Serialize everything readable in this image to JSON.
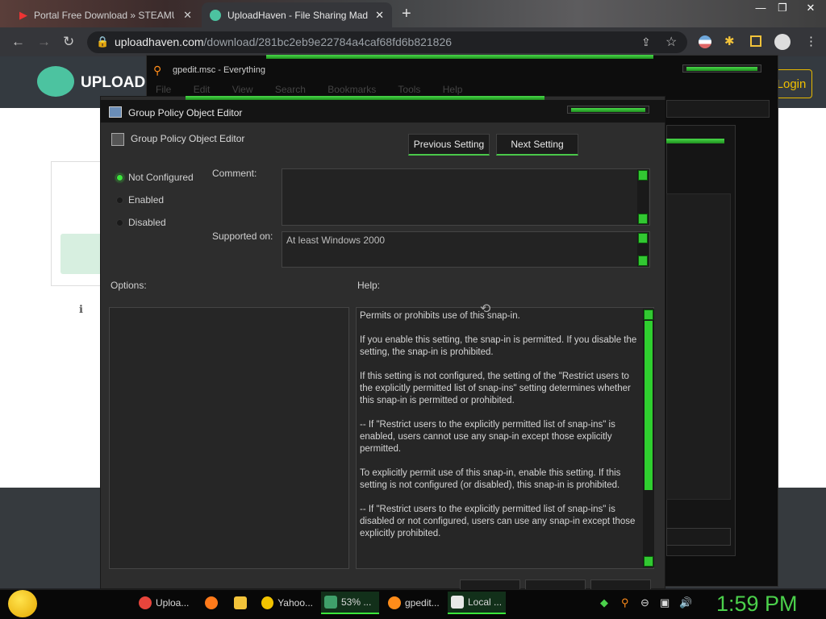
{
  "browser": {
    "tabs": [
      {
        "title": "Portal Free Download » STEAMU"
      },
      {
        "title": "UploadHaven - File Sharing Mad"
      }
    ],
    "url_domain": "uploadhaven.com",
    "url_path": "/download/281bc2eb9e22784a4caf68fd6b821826"
  },
  "website": {
    "logo_text": "UPLOADH",
    "login_label": "Login"
  },
  "everything": {
    "title": "gpedit.msc - Everything",
    "menu": [
      "File",
      "Edit",
      "View",
      "Search",
      "Bookmarks",
      "Tools",
      "Help"
    ]
  },
  "dialog": {
    "title": "Group Policy Object Editor",
    "subtitle": "Group Policy Object Editor",
    "prev_label": "Previous Setting",
    "next_label": "Next Setting",
    "radios": [
      {
        "label": "Not Configured",
        "selected": true
      },
      {
        "label": "Enabled",
        "selected": false
      },
      {
        "label": "Disabled",
        "selected": false
      }
    ],
    "comment_label": "Comment:",
    "supported_label": "Supported on:",
    "supported_value": "At least Windows 2000",
    "options_label": "Options:",
    "help_label": "Help:",
    "help_paragraphs": [
      "Permits or prohibits use of this snap-in.",
      "If you enable this setting, the snap-in is permitted. If you disable the setting, the snap-in is prohibited.",
      "If this setting is not configured, the setting of the \"Restrict users to the explicitly permitted list of snap-ins\" setting determines whether this snap-in is permitted or prohibited.",
      "--  If \"Restrict users to the explicitly permitted list of snap-ins\" is enabled, users cannot use any snap-in except those explicitly permitted.",
      "    To explicitly permit use of this snap-in, enable this setting. If this setting is not configured (or disabled), this snap-in is prohibited.",
      "--  If \"Restrict users to the explicitly permitted list of snap-ins\" is disabled or not configured, users can use any snap-in except those explicitly prohibited."
    ]
  },
  "taskbar": {
    "items": [
      {
        "label": "Uploa...",
        "icon": "chrome-icon",
        "color": "#e8453c"
      },
      {
        "label": "",
        "icon": "firefox-icon",
        "color": "#ff7a1a"
      },
      {
        "label": "",
        "icon": "folder-icon",
        "color": "#f2c33a"
      },
      {
        "label": "Yahoo...",
        "icon": "yahoo-messenger-icon",
        "color": "#f2c300"
      },
      {
        "label": "53% ...",
        "icon": "download-progress-icon",
        "color": "#3fa06a"
      },
      {
        "label": "gpedit...",
        "icon": "everything-search-icon",
        "color": "#ff8c1a"
      },
      {
        "label": "Local ...",
        "icon": "document-icon",
        "color": "#e8e8e8"
      }
    ],
    "clock": "1:59 PM"
  },
  "colors": {
    "accent_green": "#3be83b",
    "page_teal": "#4cc3a0",
    "login_gold": "#f0c000"
  }
}
